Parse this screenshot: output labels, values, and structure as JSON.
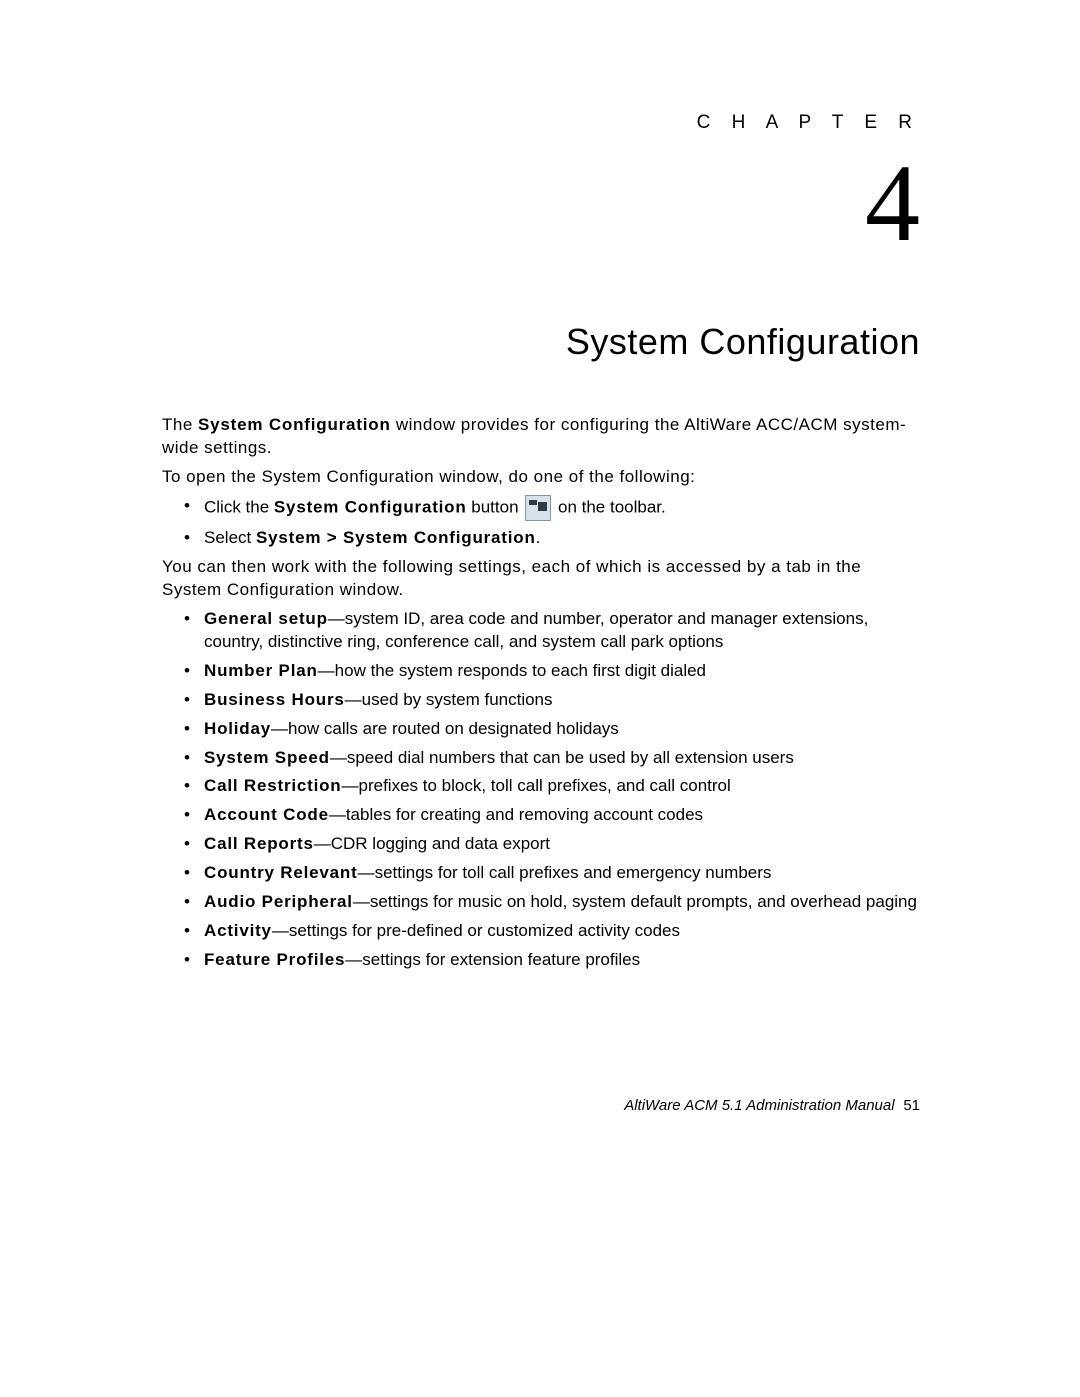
{
  "chapter_label": "C H A P T E R",
  "chapter_number": "4",
  "chapter_title": "System Configuration",
  "intro_prefix": "The ",
  "intro_bold": "System Configuration",
  "intro_suffix": " window provides for configuring the AltiWare ACC/ACM system-wide settings.",
  "open_line": "To open the System Configuration window, do one of the following:",
  "open_items": {
    "click_prefix": "Click the ",
    "click_bold": "System Configuration",
    "click_mid": " button ",
    "click_suffix": " on the toolbar.",
    "select_prefix": "Select ",
    "select_bold": "System > System Configuration",
    "select_suffix": "."
  },
  "work_line": "You can then work with the following settings, each of which is accessed by a tab in the System Configuration window.",
  "settings": [
    {
      "name": "General setup",
      "desc": "—system ID, area code and number, operator and manager extensions, country, distinctive ring, conference call, and system call park options"
    },
    {
      "name": "Number Plan",
      "desc": "—how the system responds to each first digit dialed"
    },
    {
      "name": "Business Hours",
      "desc": "—used by system functions"
    },
    {
      "name": "Holiday",
      "desc": "—how calls are routed on designated holidays"
    },
    {
      "name": "System Speed",
      "desc": "—speed dial numbers that can be used by all extension users"
    },
    {
      "name": "Call Restriction",
      "desc": "—prefixes to block, toll call prefixes, and call control"
    },
    {
      "name": "Account Code",
      "desc": "—tables for creating and removing account codes"
    },
    {
      "name": "Call Reports",
      "desc": "—CDR logging and data export"
    },
    {
      "name": "Country Relevant",
      "desc": "—settings for toll call prefixes and emergency numbers"
    },
    {
      "name": "Audio Peripheral",
      "desc": "—settings for music on hold, system default prompts, and overhead paging"
    },
    {
      "name": "Activity",
      "desc": "—settings for pre-defined or customized activity codes"
    },
    {
      "name": "Feature Profiles",
      "desc": "—settings for extension feature profiles"
    }
  ],
  "footer_text": "AltiWare ACM 5.1 Administration Manual",
  "footer_page": "51"
}
